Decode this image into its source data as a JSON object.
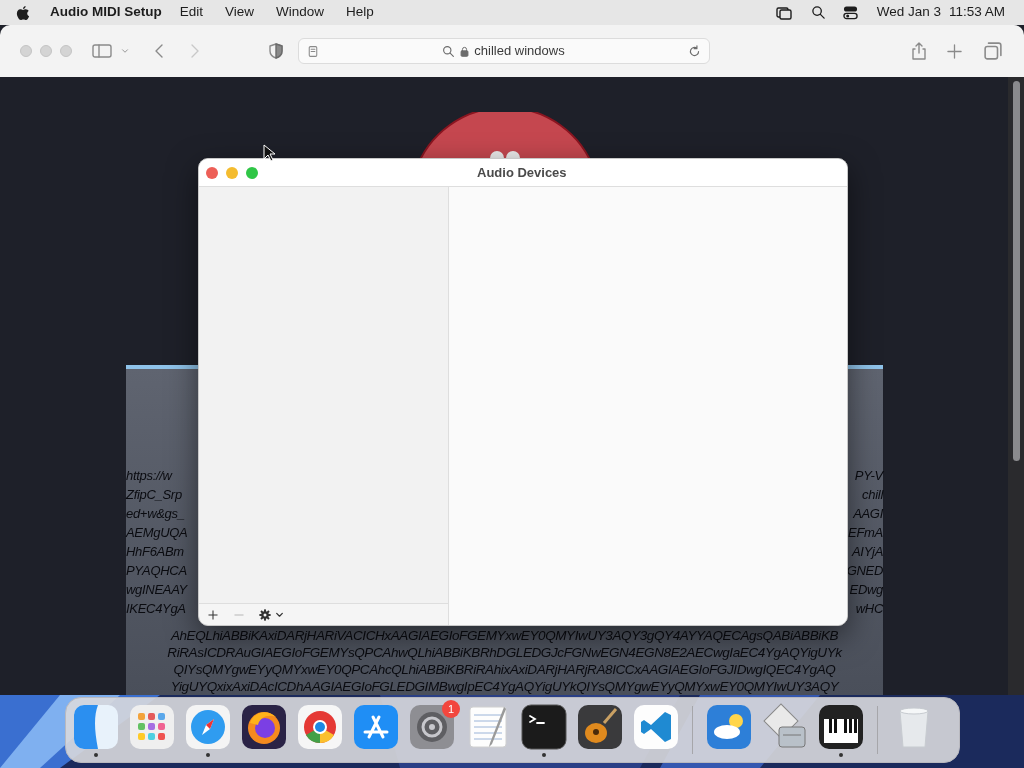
{
  "menu_bar": {
    "app_name": "Audio MIDI Setup",
    "menus": [
      "Edit",
      "View",
      "Window",
      "Help"
    ],
    "date": "Wed Jan 3",
    "time": "11:53 AM"
  },
  "browser": {
    "address": "chilled windows",
    "back_disabled": false,
    "forward_disabled": true,
    "page": {
      "left_fragments": [
        "https://w",
        "ZfipC_Srp",
        "ed+w&gs_",
        "AEMgUQA",
        "HhF6ABm",
        "PYAQHCA",
        "wgINEAAY",
        "IKEC4YgA"
      ],
      "right_fragments": [
        "PY-V",
        "chill",
        "AAGI",
        "EFmA",
        "AIYjA",
        "GNED",
        "EDwg",
        "wHC"
      ],
      "lines": [
        "AhEQLhiABBiKAxiDARjHARiVACICHxAAGIAEGIoFGEMYxwEY0QMYIwUY3AQY3gQY4AYYAQECAgsQABiABBiKB",
        "RiRAsICDRAuGIAEGIoFGEMYsQPCAhwQLhiABBiKBRhDGLEDGJcFGNwEGN4EGN8E2AECwgIaEC4YgAQYigUYk",
        "QIYsQMYgwEYyQMYxwEY0QPCAhcQLhiABBiKBRiRAhixAxiDARjHARjRA8ICCxAAGIAEGIoFGJIDwgIQEC4YgAQ",
        "YigUYQxixAxiDAcICDhAAGIAEGIoFGLEDGIMBwgIpEC4YgAQYigUYkQIYsQMYgwEYyQMYxwEY0QMYIwUY3AQY"
      ]
    }
  },
  "window": {
    "title": "Audio Devices",
    "add_disabled": false,
    "remove_disabled": true
  },
  "dock": [
    {
      "kind": "finder",
      "running": true
    },
    {
      "kind": "launchpad",
      "running": false
    },
    {
      "kind": "safari",
      "running": true
    },
    {
      "kind": "firefox",
      "running": false
    },
    {
      "kind": "chrome",
      "running": false
    },
    {
      "kind": "appstore",
      "running": false
    },
    {
      "kind": "settings",
      "running": false,
      "badge": "1"
    },
    {
      "kind": "textedit",
      "running": false
    },
    {
      "kind": "terminal",
      "running": true
    },
    {
      "kind": "guitar",
      "running": false
    },
    {
      "kind": "code",
      "running": false
    },
    {
      "kind": "separator"
    },
    {
      "kind": "weather",
      "running": false
    },
    {
      "kind": "utility",
      "running": false
    },
    {
      "kind": "piano",
      "running": true
    },
    {
      "kind": "separator"
    },
    {
      "kind": "trash",
      "running": false
    }
  ]
}
